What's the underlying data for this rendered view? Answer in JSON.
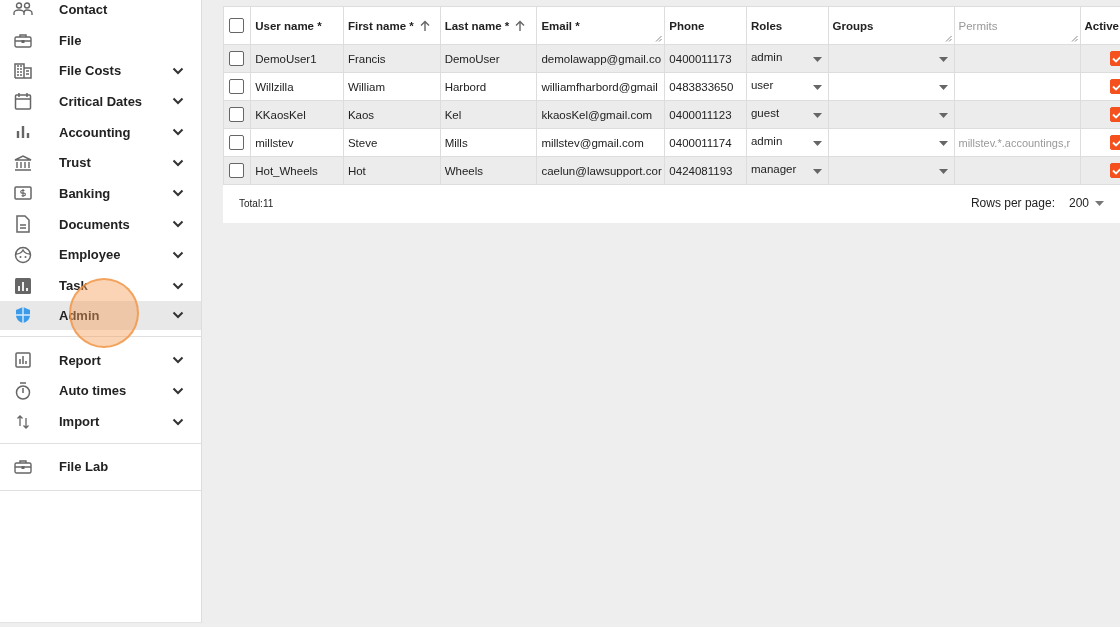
{
  "sidebar": {
    "groups": [
      {
        "items": [
          {
            "label": "Contact",
            "expandable": false,
            "selected": false
          },
          {
            "label": "File",
            "expandable": false,
            "selected": false
          },
          {
            "label": "File Costs",
            "expandable": true,
            "selected": false
          },
          {
            "label": "Critical Dates",
            "expandable": true,
            "selected": false
          },
          {
            "label": "Accounting",
            "expandable": true,
            "selected": false
          },
          {
            "label": "Trust",
            "expandable": true,
            "selected": false
          },
          {
            "label": "Banking",
            "expandable": true,
            "selected": false
          },
          {
            "label": "Documents",
            "expandable": true,
            "selected": false
          },
          {
            "label": "Employee",
            "expandable": true,
            "selected": false
          },
          {
            "label": "Task",
            "expandable": true,
            "selected": false
          },
          {
            "label": "Admin",
            "expandable": true,
            "selected": true
          }
        ]
      },
      {
        "items": [
          {
            "label": "Report",
            "expandable": true,
            "selected": false
          },
          {
            "label": "Auto times",
            "expandable": true,
            "selected": false
          },
          {
            "label": "Import",
            "expandable": true,
            "selected": false
          }
        ]
      },
      {
        "items": [
          {
            "label": "File Lab",
            "expandable": false,
            "selected": false
          }
        ]
      }
    ]
  },
  "table": {
    "select_all": {
      "checked": false
    },
    "columns": [
      {
        "label": "User name *",
        "sorted": false,
        "resizable": false,
        "disabled": false
      },
      {
        "label": "First name *",
        "sorted": true,
        "resizable": false,
        "disabled": false
      },
      {
        "label": "Last name *",
        "sorted": true,
        "resizable": false,
        "disabled": false
      },
      {
        "label": "Email *",
        "sorted": false,
        "resizable": true,
        "disabled": false
      },
      {
        "label": "Phone",
        "sorted": false,
        "resizable": false,
        "disabled": false
      },
      {
        "label": "Roles",
        "sorted": false,
        "resizable": false,
        "disabled": false
      },
      {
        "label": "Groups",
        "sorted": false,
        "resizable": true,
        "disabled": false
      },
      {
        "label": "Permits",
        "sorted": false,
        "resizable": true,
        "disabled": true
      },
      {
        "label": "Active",
        "disabled": false
      }
    ],
    "rows": [
      {
        "checked": false,
        "user_name": "DemoUser1",
        "first_name": "Francis",
        "last_name": "DemoUser",
        "email": "demolawapp@gmail.co",
        "phone": "0400011173",
        "role": "admin",
        "active": true
      },
      {
        "checked": false,
        "user_name": "Willzilla",
        "first_name": "William",
        "last_name": "Harbord",
        "email": "williamfharbord@gmail",
        "phone": "0483833650",
        "role": "user",
        "active": true
      },
      {
        "checked": false,
        "user_name": "KKaosKel",
        "first_name": "Kaos",
        "last_name": "Kel",
        "email": "kkaosKel@gmail.com",
        "phone": "0400011123",
        "role": "guest",
        "active": true
      },
      {
        "checked": false,
        "user_name": "millstev",
        "first_name": "Steve",
        "last_name": "Mills",
        "email": "millstev@gmail.com",
        "phone": "0400011174",
        "role": "admin",
        "permits": "millstev.*.accountings,r",
        "active": true
      },
      {
        "checked": false,
        "user_name": "Hot_Wheels",
        "first_name": "Hot",
        "last_name": "Wheels",
        "email": "caelun@lawsupport.cor",
        "phone": "0424081193",
        "role": "manager",
        "active": true
      }
    ],
    "total": "Total:11",
    "rows_per_page_label": "Rows per page:",
    "rows_per_page": "200"
  }
}
